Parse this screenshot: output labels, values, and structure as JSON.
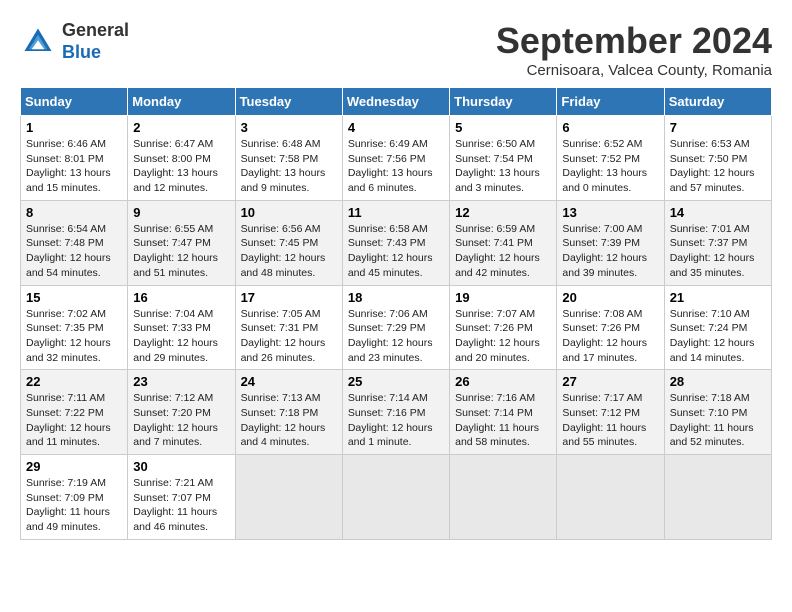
{
  "header": {
    "logo_general": "General",
    "logo_blue": "Blue",
    "title": "September 2024",
    "subtitle": "Cernisoara, Valcea County, Romania"
  },
  "columns": [
    "Sunday",
    "Monday",
    "Tuesday",
    "Wednesday",
    "Thursday",
    "Friday",
    "Saturday"
  ],
  "weeks": [
    [
      {
        "day": "1",
        "info": "Sunrise: 6:46 AM\nSunset: 8:01 PM\nDaylight: 13 hours and 15 minutes."
      },
      {
        "day": "2",
        "info": "Sunrise: 6:47 AM\nSunset: 8:00 PM\nDaylight: 13 hours and 12 minutes."
      },
      {
        "day": "3",
        "info": "Sunrise: 6:48 AM\nSunset: 7:58 PM\nDaylight: 13 hours and 9 minutes."
      },
      {
        "day": "4",
        "info": "Sunrise: 6:49 AM\nSunset: 7:56 PM\nDaylight: 13 hours and 6 minutes."
      },
      {
        "day": "5",
        "info": "Sunrise: 6:50 AM\nSunset: 7:54 PM\nDaylight: 13 hours and 3 minutes."
      },
      {
        "day": "6",
        "info": "Sunrise: 6:52 AM\nSunset: 7:52 PM\nDaylight: 13 hours and 0 minutes."
      },
      {
        "day": "7",
        "info": "Sunrise: 6:53 AM\nSunset: 7:50 PM\nDaylight: 12 hours and 57 minutes."
      }
    ],
    [
      {
        "day": "8",
        "info": "Sunrise: 6:54 AM\nSunset: 7:48 PM\nDaylight: 12 hours and 54 minutes."
      },
      {
        "day": "9",
        "info": "Sunrise: 6:55 AM\nSunset: 7:47 PM\nDaylight: 12 hours and 51 minutes."
      },
      {
        "day": "10",
        "info": "Sunrise: 6:56 AM\nSunset: 7:45 PM\nDaylight: 12 hours and 48 minutes."
      },
      {
        "day": "11",
        "info": "Sunrise: 6:58 AM\nSunset: 7:43 PM\nDaylight: 12 hours and 45 minutes."
      },
      {
        "day": "12",
        "info": "Sunrise: 6:59 AM\nSunset: 7:41 PM\nDaylight: 12 hours and 42 minutes."
      },
      {
        "day": "13",
        "info": "Sunrise: 7:00 AM\nSunset: 7:39 PM\nDaylight: 12 hours and 39 minutes."
      },
      {
        "day": "14",
        "info": "Sunrise: 7:01 AM\nSunset: 7:37 PM\nDaylight: 12 hours and 35 minutes."
      }
    ],
    [
      {
        "day": "15",
        "info": "Sunrise: 7:02 AM\nSunset: 7:35 PM\nDaylight: 12 hours and 32 minutes."
      },
      {
        "day": "16",
        "info": "Sunrise: 7:04 AM\nSunset: 7:33 PM\nDaylight: 12 hours and 29 minutes."
      },
      {
        "day": "17",
        "info": "Sunrise: 7:05 AM\nSunset: 7:31 PM\nDaylight: 12 hours and 26 minutes."
      },
      {
        "day": "18",
        "info": "Sunrise: 7:06 AM\nSunset: 7:29 PM\nDaylight: 12 hours and 23 minutes."
      },
      {
        "day": "19",
        "info": "Sunrise: 7:07 AM\nSunset: 7:26 PM\nDaylight: 12 hours and 20 minutes."
      },
      {
        "day": "20",
        "info": "Sunrise: 7:08 AM\nSunset: 7:26 PM\nDaylight: 12 hours and 17 minutes."
      },
      {
        "day": "21",
        "info": "Sunrise: 7:10 AM\nSunset: 7:24 PM\nDaylight: 12 hours and 14 minutes."
      }
    ],
    [
      {
        "day": "22",
        "info": "Sunrise: 7:11 AM\nSunset: 7:22 PM\nDaylight: 12 hours and 11 minutes."
      },
      {
        "day": "23",
        "info": "Sunrise: 7:12 AM\nSunset: 7:20 PM\nDaylight: 12 hours and 7 minutes."
      },
      {
        "day": "24",
        "info": "Sunrise: 7:13 AM\nSunset: 7:18 PM\nDaylight: 12 hours and 4 minutes."
      },
      {
        "day": "25",
        "info": "Sunrise: 7:14 AM\nSunset: 7:16 PM\nDaylight: 12 hours and 1 minute."
      },
      {
        "day": "26",
        "info": "Sunrise: 7:16 AM\nSunset: 7:14 PM\nDaylight: 11 hours and 58 minutes."
      },
      {
        "day": "27",
        "info": "Sunrise: 7:17 AM\nSunset: 7:12 PM\nDaylight: 11 hours and 55 minutes."
      },
      {
        "day": "28",
        "info": "Sunrise: 7:18 AM\nSunset: 7:10 PM\nDaylight: 11 hours and 52 minutes."
      }
    ],
    [
      {
        "day": "29",
        "info": "Sunrise: 7:19 AM\nSunset: 7:09 PM\nDaylight: 11 hours and 49 minutes."
      },
      {
        "day": "30",
        "info": "Sunrise: 7:21 AM\nSunset: 7:07 PM\nDaylight: 11 hours and 46 minutes."
      },
      {
        "day": "",
        "info": ""
      },
      {
        "day": "",
        "info": ""
      },
      {
        "day": "",
        "info": ""
      },
      {
        "day": "",
        "info": ""
      },
      {
        "day": "",
        "info": ""
      }
    ]
  ]
}
